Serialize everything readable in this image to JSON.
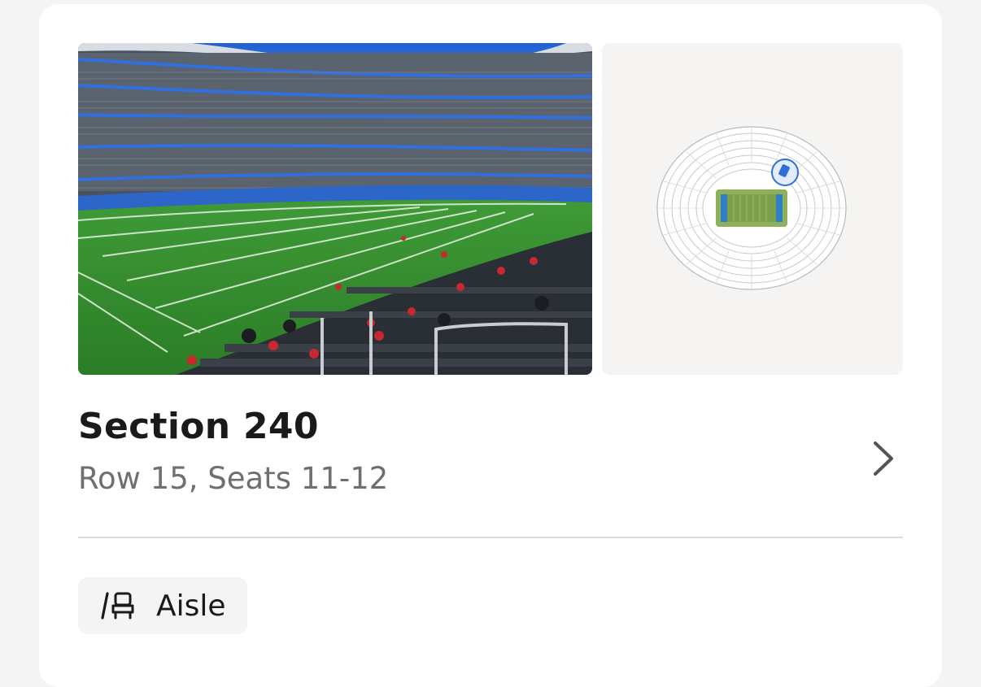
{
  "listing": {
    "section_title": "Section 240",
    "seat_detail": "Row 15, Seats 11-12",
    "feature_label": "Aisle",
    "feature_icon": "aisle-seat-icon",
    "chevron_icon": "chevron-right-icon"
  },
  "colors": {
    "title_text": "#1a1a1a",
    "secondary_text": "#6f6f6f",
    "map_background": "#f5f4f3",
    "selected_section": "#2f6fd6",
    "field_green": "#7ea04a",
    "endzone_blue": "#2f7fc6"
  }
}
